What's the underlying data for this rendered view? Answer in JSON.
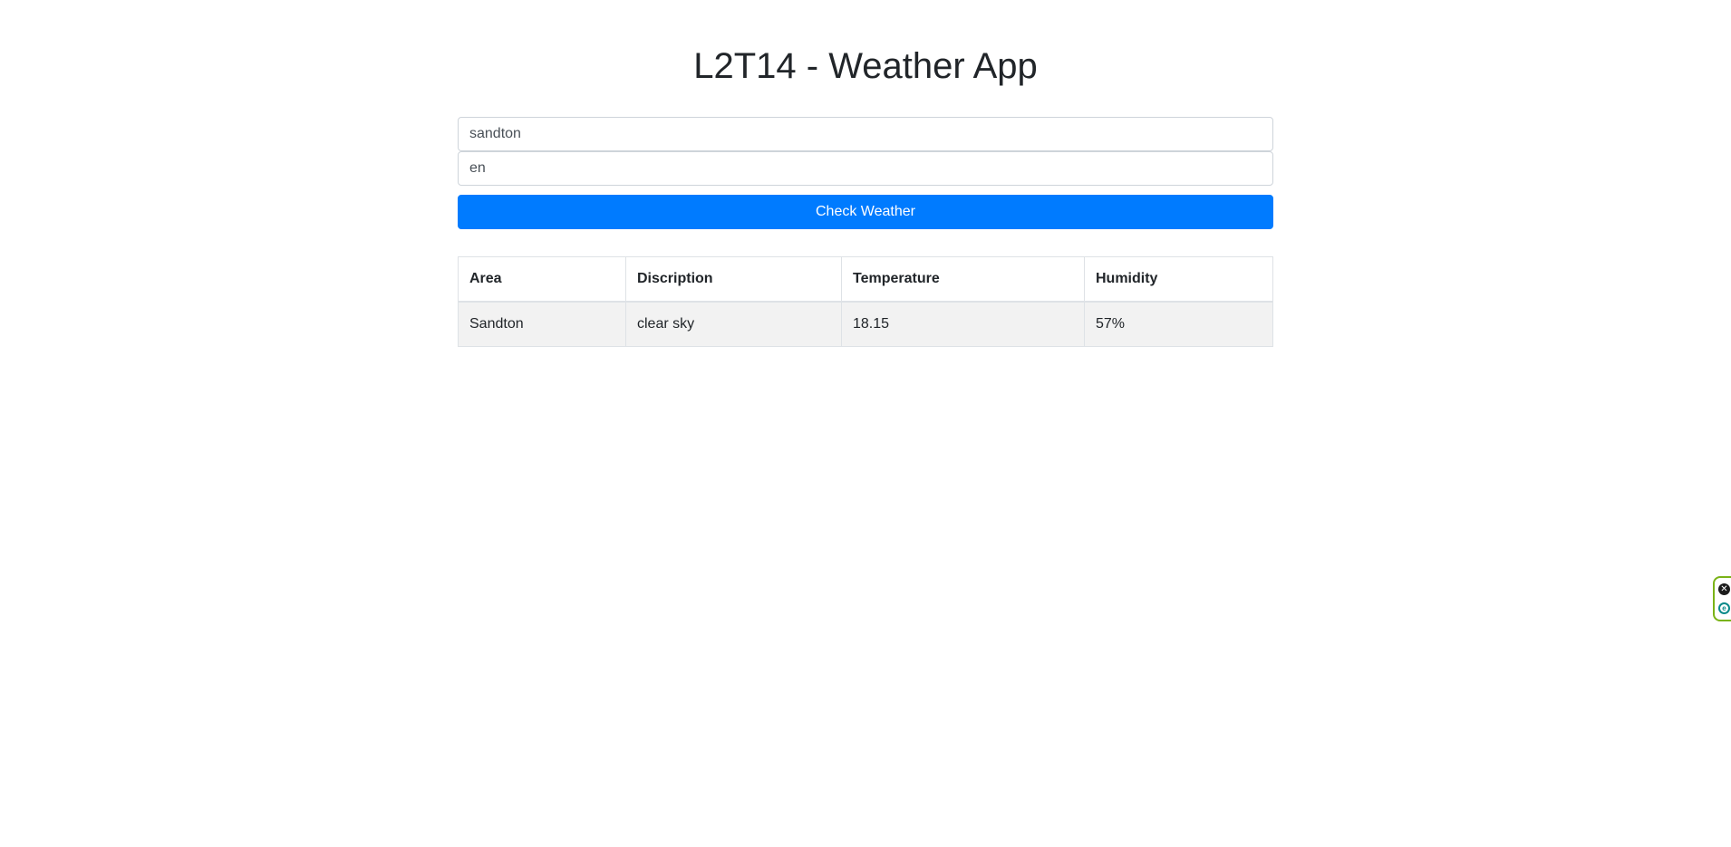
{
  "app": {
    "title": "L2T14 - Weather App"
  },
  "form": {
    "city_value": "sandton",
    "lang_value": "en",
    "submit_label": "Check Weather"
  },
  "table": {
    "headers": [
      "Area",
      "Discription",
      "Temperature",
      "Humidity"
    ],
    "rows": [
      [
        "Sandton",
        "clear sky",
        "18.15",
        "57%"
      ]
    ]
  },
  "colors": {
    "accent": "#007bff",
    "row_background": "#f2f2f2",
    "widget_border": "#7ab317"
  },
  "side_widget": {
    "icons": [
      "close-icon",
      "extension-icon"
    ]
  }
}
